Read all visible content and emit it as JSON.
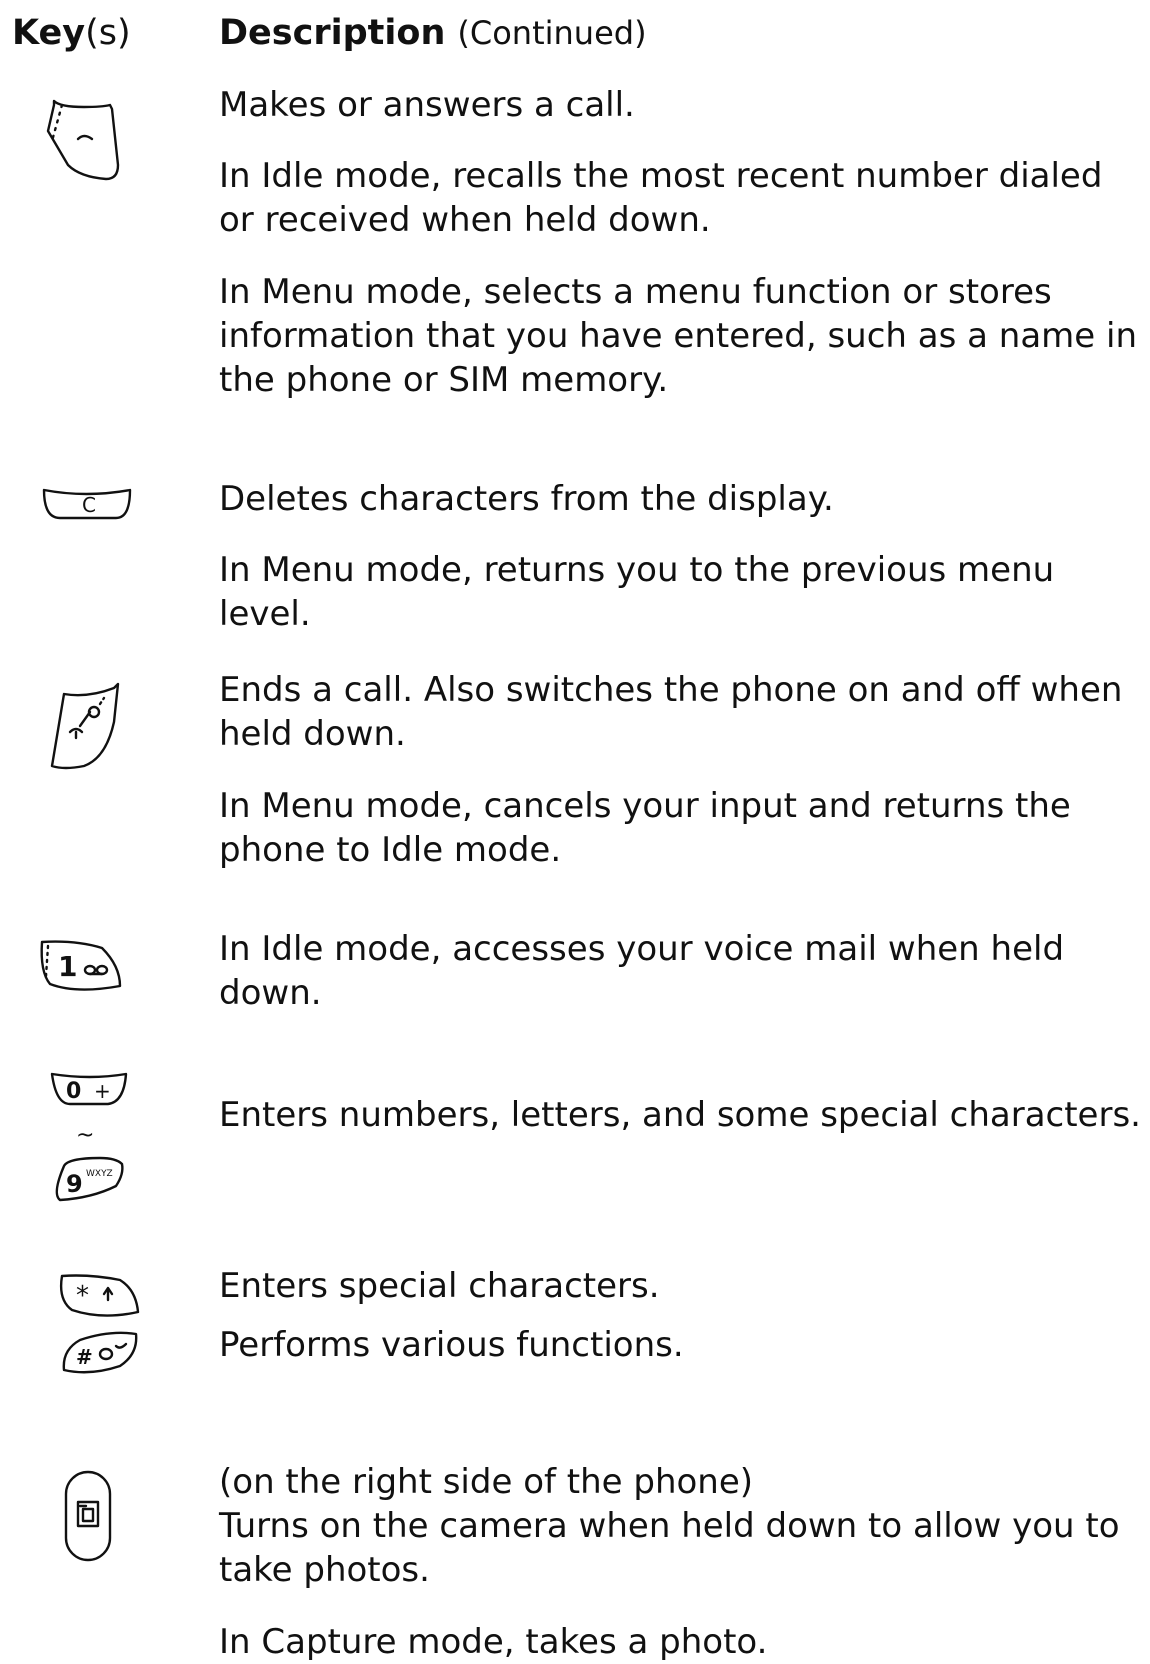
{
  "header": {
    "key_bold": "Key",
    "key_rest": "(s)",
    "description": "Description",
    "continued": "(Continued)"
  },
  "rows": [
    {
      "icon": "send-key-icon",
      "lines": [
        [
          "Makes or answers a call."
        ],
        [
          "In Idle mode, recalls the most recent number dialed",
          "or received when held down."
        ],
        [
          "In Menu mode, selects a menu function or stores",
          "information that you have entered, such as a name in",
          "the phone or SIM memory."
        ]
      ]
    },
    {
      "icon": "clear-key-icon",
      "icon_label": "C",
      "lines": [
        [
          "Deletes characters from the display."
        ],
        [
          "In Menu mode, returns you to the previous menu",
          "level."
        ]
      ]
    },
    {
      "icon": "end-power-key-icon",
      "lines": [
        [
          "Ends a call. Also switches the phone on and off when",
          "held down."
        ],
        [
          "In Menu mode, cancels your input and returns the",
          "phone to Idle mode."
        ]
      ]
    },
    {
      "icon": "voicemail-1-key-icon",
      "icon_label": "1",
      "lines": [
        [
          "In Idle mode, accesses your voice mail when held",
          "down."
        ]
      ]
    },
    {
      "icon": "number-keys-icon",
      "icon_labels": [
        "0",
        "+",
        "~",
        "9",
        "WXYZ"
      ],
      "lines": [
        [
          "Enters numbers, letters, and some special characters."
        ]
      ]
    },
    {
      "icon": "star-hash-keys-icon",
      "icon_labels": [
        "*",
        "#"
      ],
      "lines": [
        [
          "Enters special characters."
        ],
        [
          "Performs various functions."
        ]
      ]
    },
    {
      "icon": "camera-key-icon",
      "lines": [
        [
          "(on the right side of the phone)",
          "Turns on the camera when held down to allow you to",
          "take photos."
        ],
        [
          "In Capture mode, takes a photo."
        ]
      ]
    }
  ]
}
